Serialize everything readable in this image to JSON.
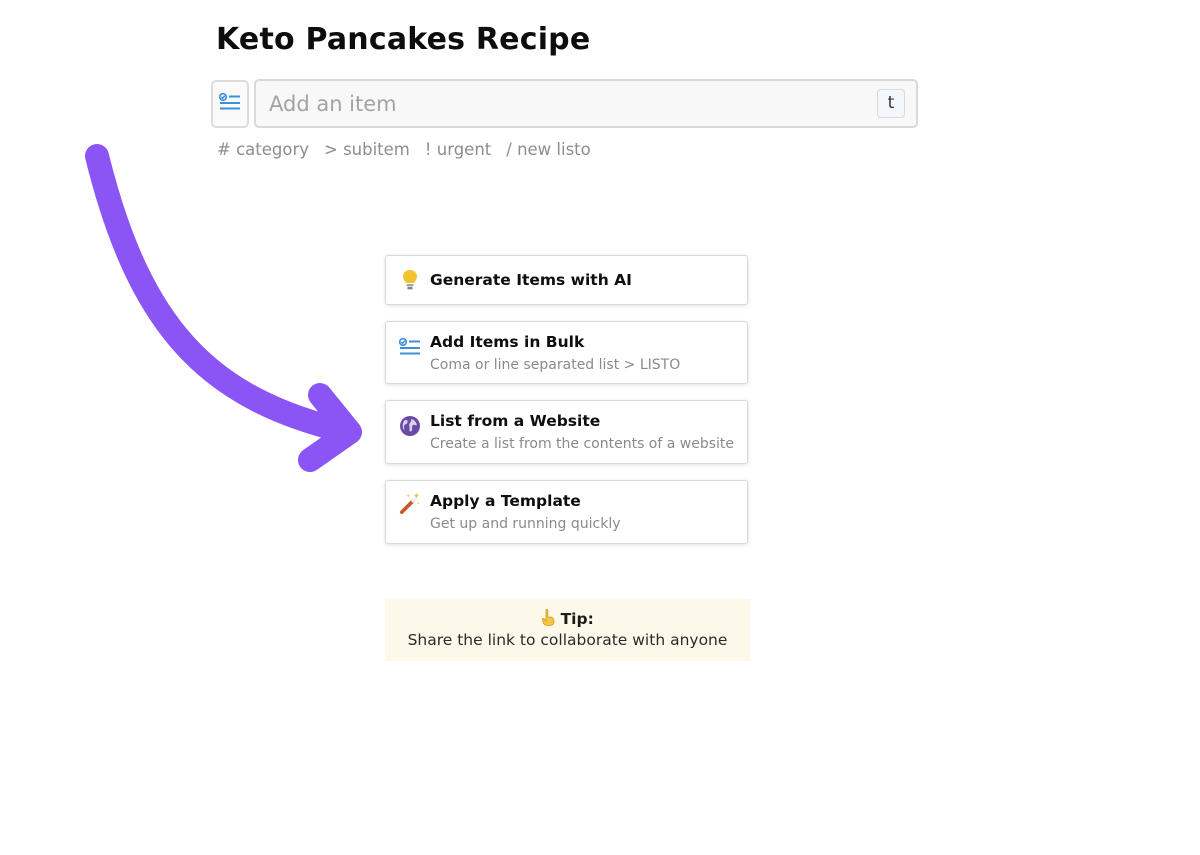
{
  "header": {
    "title": "Keto Pancakes Recipe"
  },
  "composer": {
    "placeholder": "Add an item",
    "shortcut_key": "t",
    "list_button_icon": "checklist-icon"
  },
  "hints": [
    "# category",
    "> subitem",
    "! urgent",
    "/ new listo"
  ],
  "actions": [
    {
      "icon": "lightbulb-icon",
      "title": "Generate Items with AI",
      "subtitle": ""
    },
    {
      "icon": "checklist-icon",
      "title": "Add Items in Bulk",
      "subtitle": "Coma or line separated list > LISTO"
    },
    {
      "icon": "globe-icon",
      "title": "List from a Website",
      "subtitle": "Create a list from the contents of a website"
    },
    {
      "icon": "magic-wand-icon",
      "title": "Apply a Template",
      "subtitle": "Get up and running quickly"
    }
  ],
  "tip": {
    "icon": "pointing-up-icon",
    "heading": "Tip:",
    "text": "Share the link to collaborate with anyone"
  },
  "annotation": {
    "icon": "curved-arrow-icon",
    "color": "#8b55f6"
  },
  "colors": {
    "accent_blue": "#3b8fdc",
    "tip_background": "#fdf9ea"
  }
}
